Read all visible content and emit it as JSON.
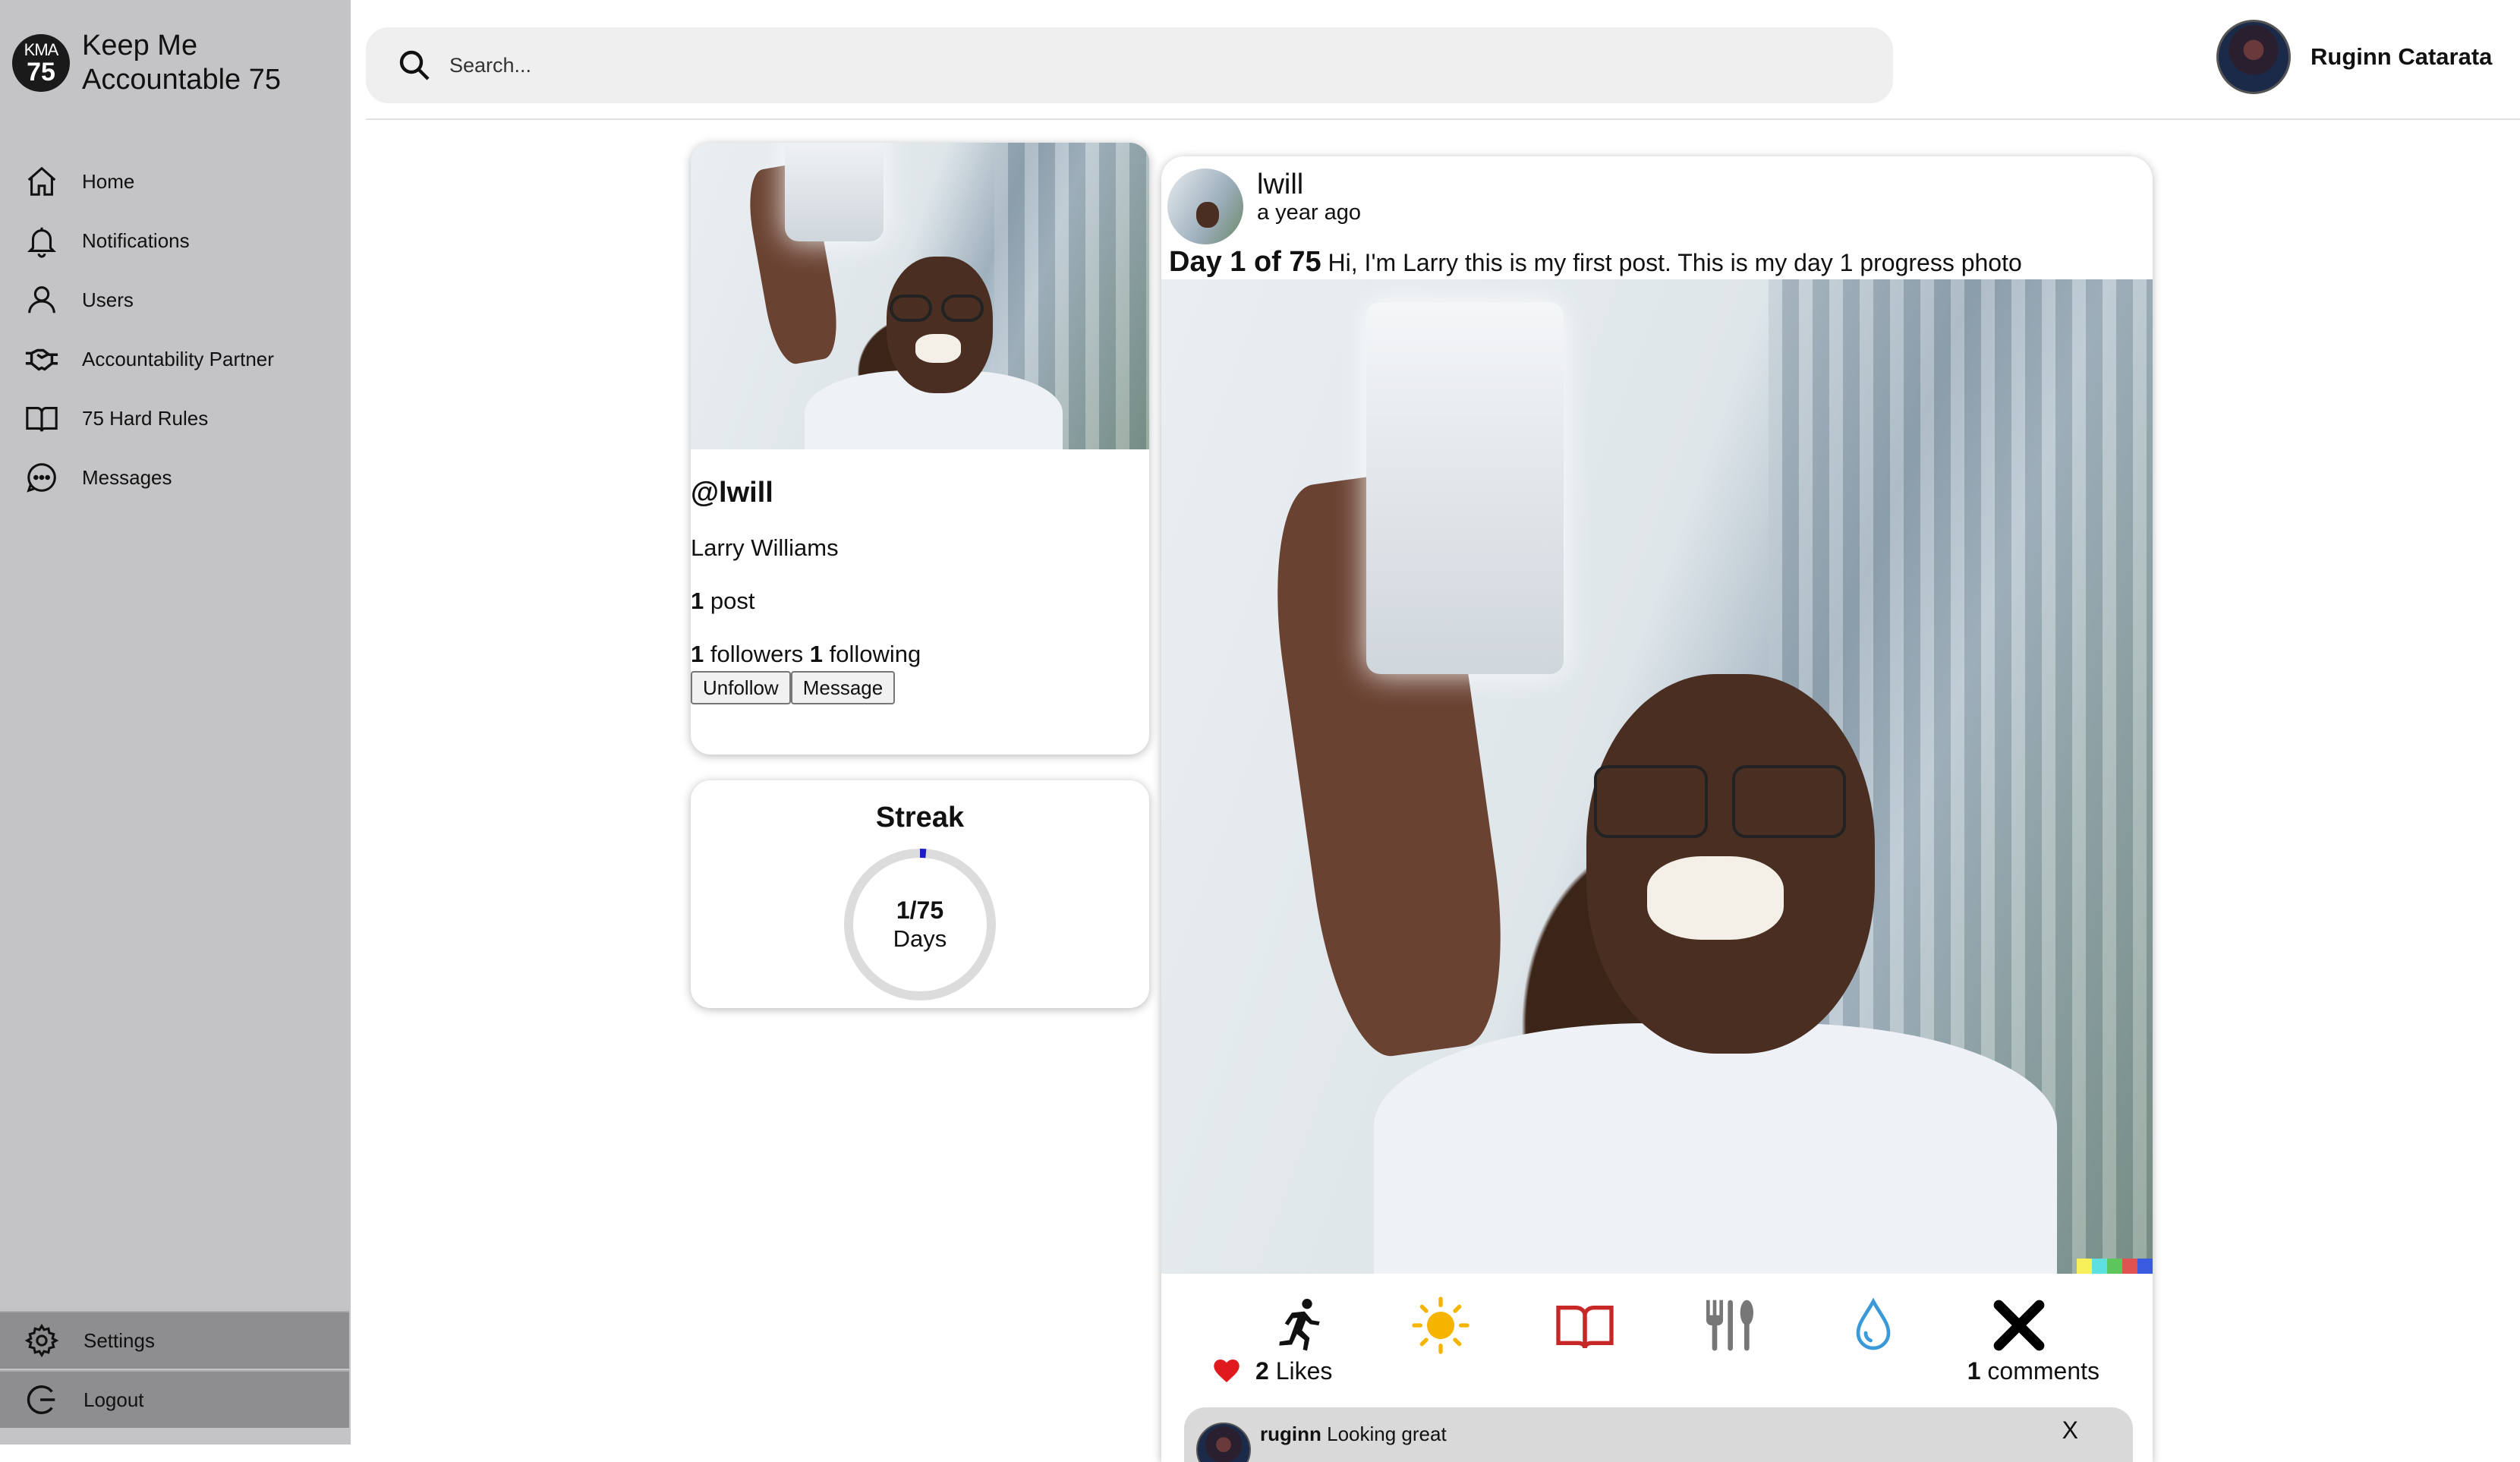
{
  "brand": {
    "logo_top": "KMA",
    "logo_bottom": "75",
    "name_line1": "Keep Me",
    "name_line2": "Accountable 75"
  },
  "nav": {
    "items": [
      {
        "label": "Home",
        "icon": "home-icon"
      },
      {
        "label": "Notifications",
        "icon": "bell-icon"
      },
      {
        "label": "Users",
        "icon": "user-icon"
      },
      {
        "label": "Accountability Partner",
        "icon": "handshake-icon"
      },
      {
        "label": "75 Hard Rules",
        "icon": "book-icon"
      },
      {
        "label": "Messages",
        "icon": "chat-icon"
      }
    ],
    "bottom": [
      {
        "label": "Settings",
        "icon": "gear-icon"
      },
      {
        "label": "Logout",
        "icon": "logout-icon"
      }
    ]
  },
  "search": {
    "placeholder": "Search..."
  },
  "current_user": {
    "name": "Ruginn Catarata"
  },
  "profile": {
    "handle": "@lwill",
    "full_name": "Larry Williams",
    "posts_count": "1",
    "posts_label": " post",
    "followers_count": "1",
    "followers_label": " followers ",
    "following_count": "1",
    "following_label": " following",
    "unfollow_label": "Unfollow",
    "message_label": "Message"
  },
  "streak": {
    "title": "Streak",
    "value": "1/75",
    "unit": "Days",
    "progress": 0.0133
  },
  "post": {
    "username": "lwill",
    "time_ago": "a year ago",
    "day_label": "Day 1 of 75",
    "caption": " Hi, I'm Larry this is my first post. This is my day 1 progress photo",
    "color_strip": [
      "#f7f05a",
      "#5ee0e0",
      "#5cc65c",
      "#e05252",
      "#3a5ae0"
    ],
    "tasks": [
      {
        "icon": "running-icon",
        "color": "#111111"
      },
      {
        "icon": "sun-icon",
        "color": "#f5b400"
      },
      {
        "icon": "book-open-icon",
        "color": "#c62828"
      },
      {
        "icon": "utensils-icon",
        "color": "#777777"
      },
      {
        "icon": "water-drop-icon",
        "color": "#3a9ad9"
      },
      {
        "icon": "x-mark-icon",
        "color": "#000000"
      }
    ],
    "likes_count": "2",
    "likes_label": "Likes",
    "comments_count": "1",
    "comments_label": "comments",
    "like_color": "#e0191f"
  },
  "comment": {
    "author": "ruginn",
    "text": "Looking great",
    "close": "X"
  }
}
